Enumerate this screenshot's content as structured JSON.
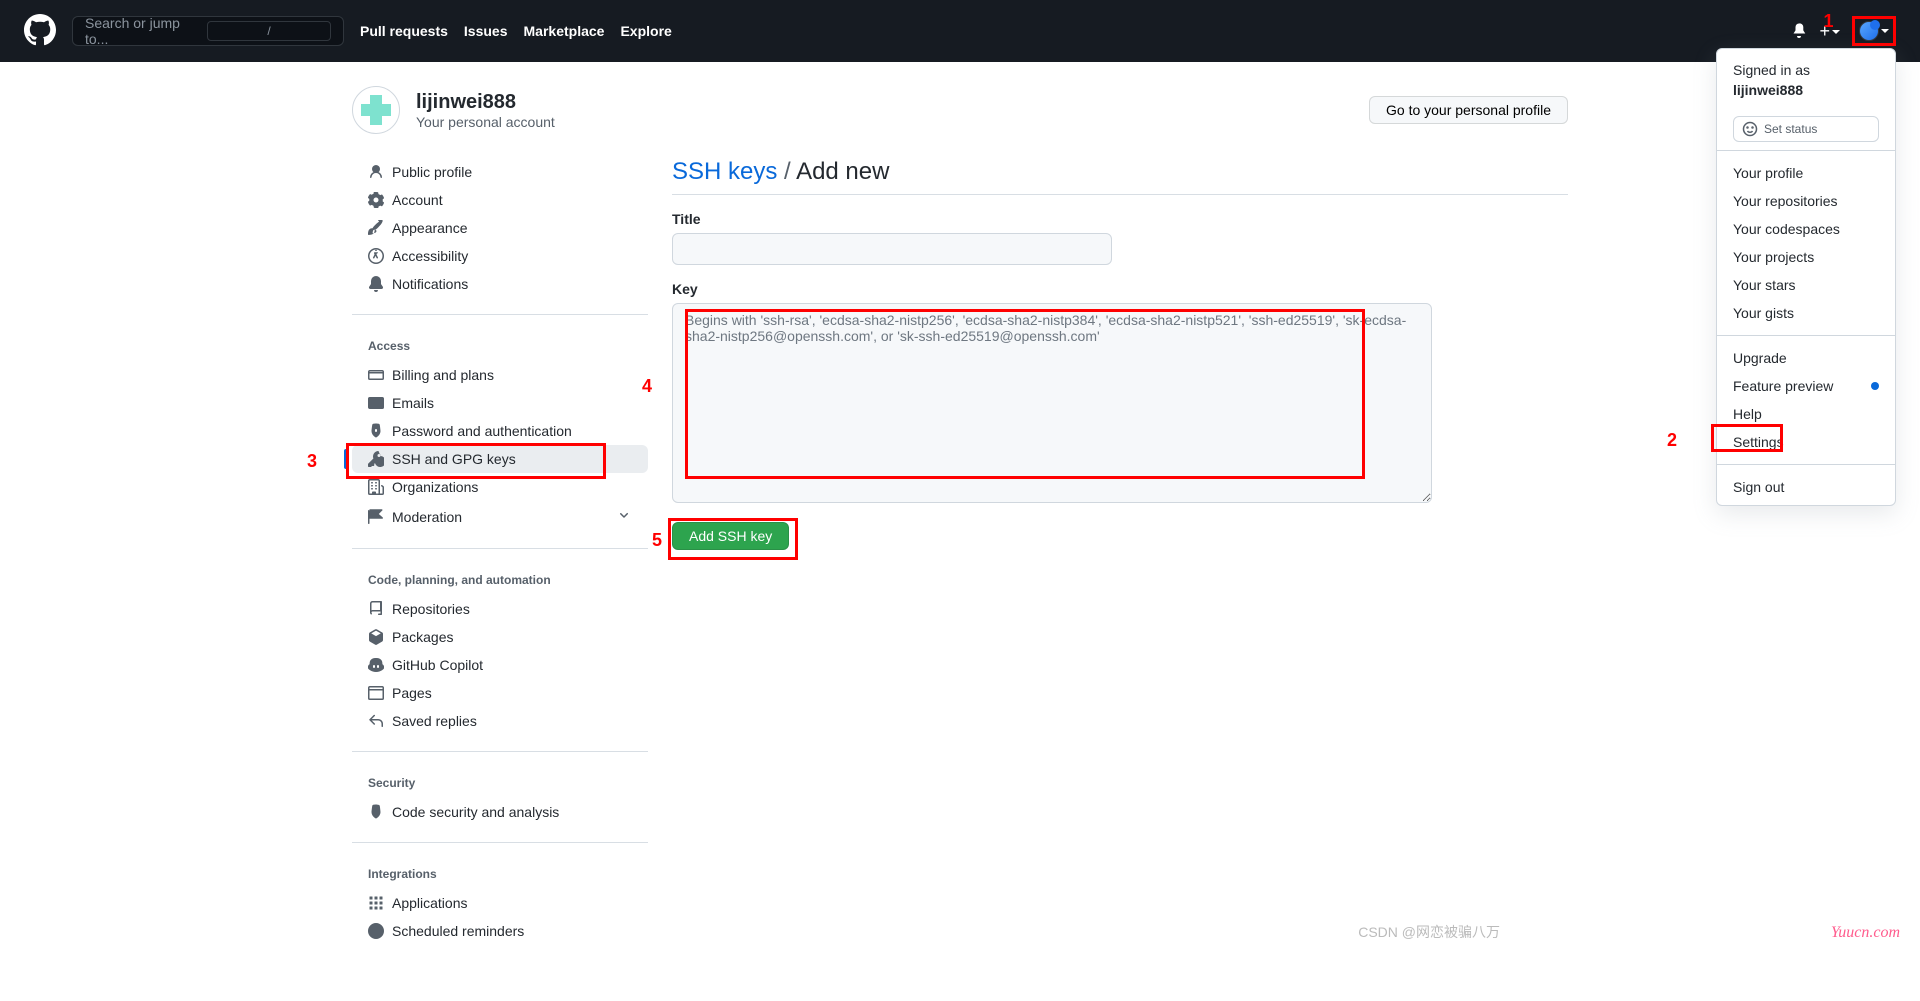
{
  "header": {
    "search_placeholder": "Search or jump to...",
    "nav": [
      "Pull requests",
      "Issues",
      "Marketplace",
      "Explore"
    ]
  },
  "dropdown": {
    "signed_in_label": "Signed in as",
    "username": "lijinwei888",
    "set_status": "Set status",
    "groups": [
      [
        "Your profile",
        "Your repositories",
        "Your codespaces",
        "Your projects",
        "Your stars",
        "Your gists"
      ],
      [
        "Upgrade",
        "Feature preview",
        "Help",
        "Settings"
      ],
      [
        "Sign out"
      ]
    ]
  },
  "profile": {
    "username": "lijinwei888",
    "subtitle": "Your personal account",
    "go_profile": "Go to your personal profile"
  },
  "sidebar": {
    "group1": [
      {
        "icon": "person",
        "label": "Public profile"
      },
      {
        "icon": "gear",
        "label": "Account"
      },
      {
        "icon": "paint",
        "label": "Appearance"
      },
      {
        "icon": "a11y",
        "label": "Accessibility"
      },
      {
        "icon": "bell",
        "label": "Notifications"
      }
    ],
    "access_title": "Access",
    "group2": [
      {
        "icon": "card",
        "label": "Billing and plans"
      },
      {
        "icon": "mail",
        "label": "Emails"
      },
      {
        "icon": "shield",
        "label": "Password and authentication"
      },
      {
        "icon": "key",
        "label": "SSH and GPG keys"
      },
      {
        "icon": "org",
        "label": "Organizations"
      },
      {
        "icon": "mod",
        "label": "Moderation",
        "sub": true
      }
    ],
    "code_title": "Code, planning, and automation",
    "group3": [
      {
        "icon": "repo",
        "label": "Repositories"
      },
      {
        "icon": "pkg",
        "label": "Packages"
      },
      {
        "icon": "copilot",
        "label": "GitHub Copilot"
      },
      {
        "icon": "pages",
        "label": "Pages"
      },
      {
        "icon": "reply",
        "label": "Saved replies"
      }
    ],
    "security_title": "Security",
    "group4": [
      {
        "icon": "shield",
        "label": "Code security and analysis"
      }
    ],
    "integrations_title": "Integrations",
    "group5": [
      {
        "icon": "apps",
        "label": "Applications"
      },
      {
        "icon": "clock",
        "label": "Scheduled reminders"
      }
    ]
  },
  "main": {
    "crumb_link": "SSH keys",
    "crumb_sep": "/",
    "crumb_current": "Add new",
    "title_label": "Title",
    "key_label": "Key",
    "key_placeholder": "Begins with 'ssh-rsa', 'ecdsa-sha2-nistp256', 'ecdsa-sha2-nistp384', 'ecdsa-sha2-nistp521', 'ssh-ed25519', 'sk-ecdsa-sha2-nistp256@openssh.com', or 'sk-ssh-ed25519@openssh.com'",
    "submit": "Add SSH key"
  },
  "annotations": {
    "a1": "1",
    "a2": "2",
    "a3": "3",
    "a4": "4",
    "a5": "5"
  },
  "watermark1": "Yuucn.com",
  "watermark2": "CSDN @网恋被骗八万"
}
